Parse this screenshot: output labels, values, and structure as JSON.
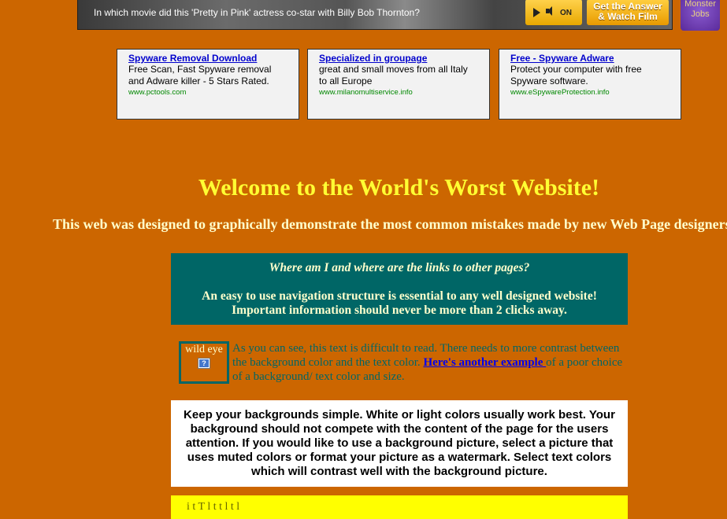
{
  "banner": {
    "question": "In which movie did this 'Pretty in Pink' actress co-star with Billy Bob Thornton?",
    "on_label": "ON",
    "cta_line1": "Get the Answer",
    "cta_line2": "& Watch Film"
  },
  "monster": {
    "line1": "Monster",
    "line2": "Jobs"
  },
  "ads": [
    {
      "title": "Spyware Removal Download",
      "body": "Free Scan, Fast Spyware removal and Adware killer - 5 Stars Rated.",
      "url": "www.pctools.com"
    },
    {
      "title": "Specialized in groupage",
      "body": "great and small moves from all Italy to all Europe",
      "url": "www.milanomultiservice.info"
    },
    {
      "title": "Free - Spyware Adware",
      "body": "Protect your computer with free Spyware software.",
      "url": "www.eSpywareProtection.info"
    }
  ],
  "welcome": "Welcome to the World's Worst Website!",
  "tagline": "This web was designed to graphically demonstrate the most common mistakes made by new Web Page designers.",
  "navbox": {
    "question": "Where am I and where are the links to other pages?",
    "line1": "An easy to use navigation structure is essential to any well designed website!",
    "line2": "Important information should never be more than 2 clicks away."
  },
  "wildeye": {
    "alt": "wild eye",
    "icon_glyph": "?"
  },
  "contrast": {
    "before": "As you can see, this text is difficult to read. There needs to more contrast between the background color and the text color. ",
    "link": "Here's another example ",
    "after": "of a poor choice of a background/ text color and size."
  },
  "whitebox": {
    "text": "Keep your backgrounds simple. White or light colors usually work best. Your background should not compete with the content of the page for the users attention. If you would like to use a background picture, select a picture that uses muted colors or format your picture as a watermark. Select text colors which will contrast well with the background picture."
  },
  "yellowbox": {
    "text": "i   t                           T             l                 t              t              l                                 t                  l"
  }
}
